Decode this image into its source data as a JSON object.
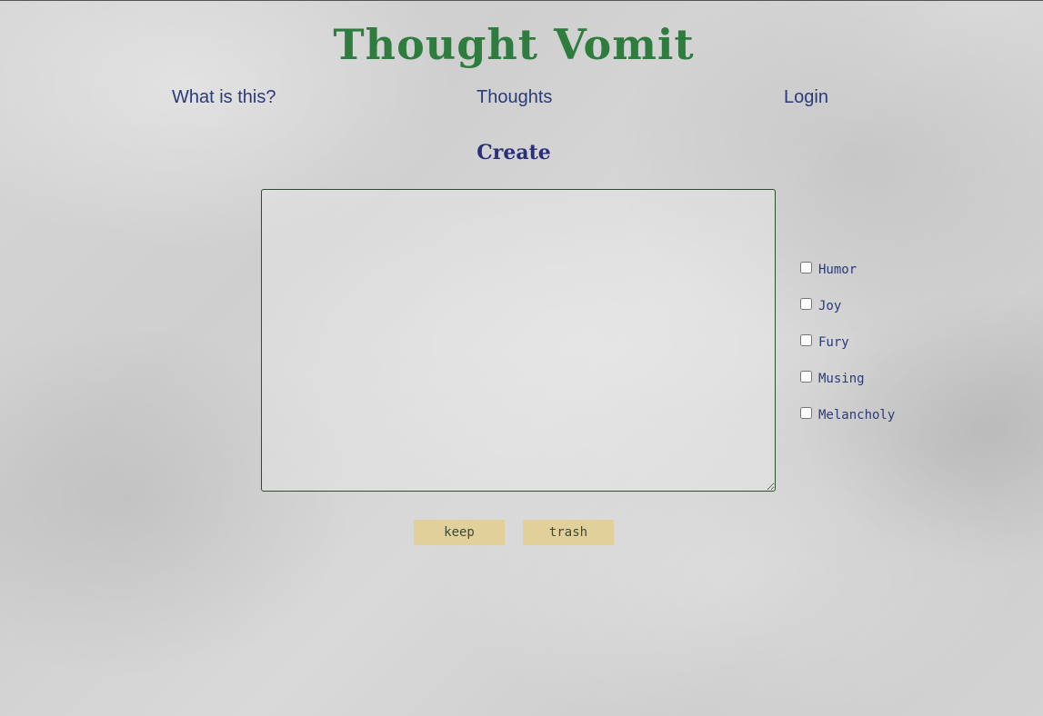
{
  "header": {
    "title": "Thought Vomit",
    "title_color": "#2e7d3e"
  },
  "nav": {
    "items": [
      {
        "label": "What is this?"
      },
      {
        "label": "Thoughts"
      },
      {
        "label": "Login"
      }
    ]
  },
  "create": {
    "heading": "Create",
    "textarea_value": "",
    "textarea_placeholder": ""
  },
  "moods": [
    {
      "label": "Humor",
      "checked": false
    },
    {
      "label": "Joy",
      "checked": false
    },
    {
      "label": "Fury",
      "checked": false
    },
    {
      "label": "Musing",
      "checked": false
    },
    {
      "label": "Melancholy",
      "checked": false
    }
  ],
  "actions": {
    "keep_label": "keep",
    "trash_label": "trash",
    "button_color": "#e1d09a"
  },
  "colors": {
    "link": "#2b3a7a",
    "heading": "#2b2f7a",
    "background": "#d4d4d4"
  }
}
